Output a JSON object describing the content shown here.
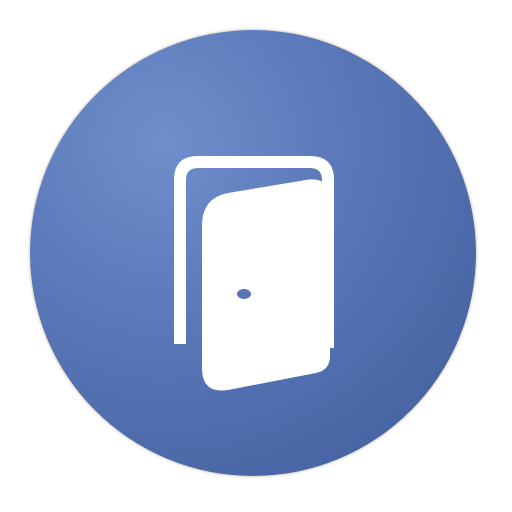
{
  "app_icon": {
    "icon": "door-icon",
    "background_color": "#5573b3",
    "foreground_color": "#ffffff"
  }
}
